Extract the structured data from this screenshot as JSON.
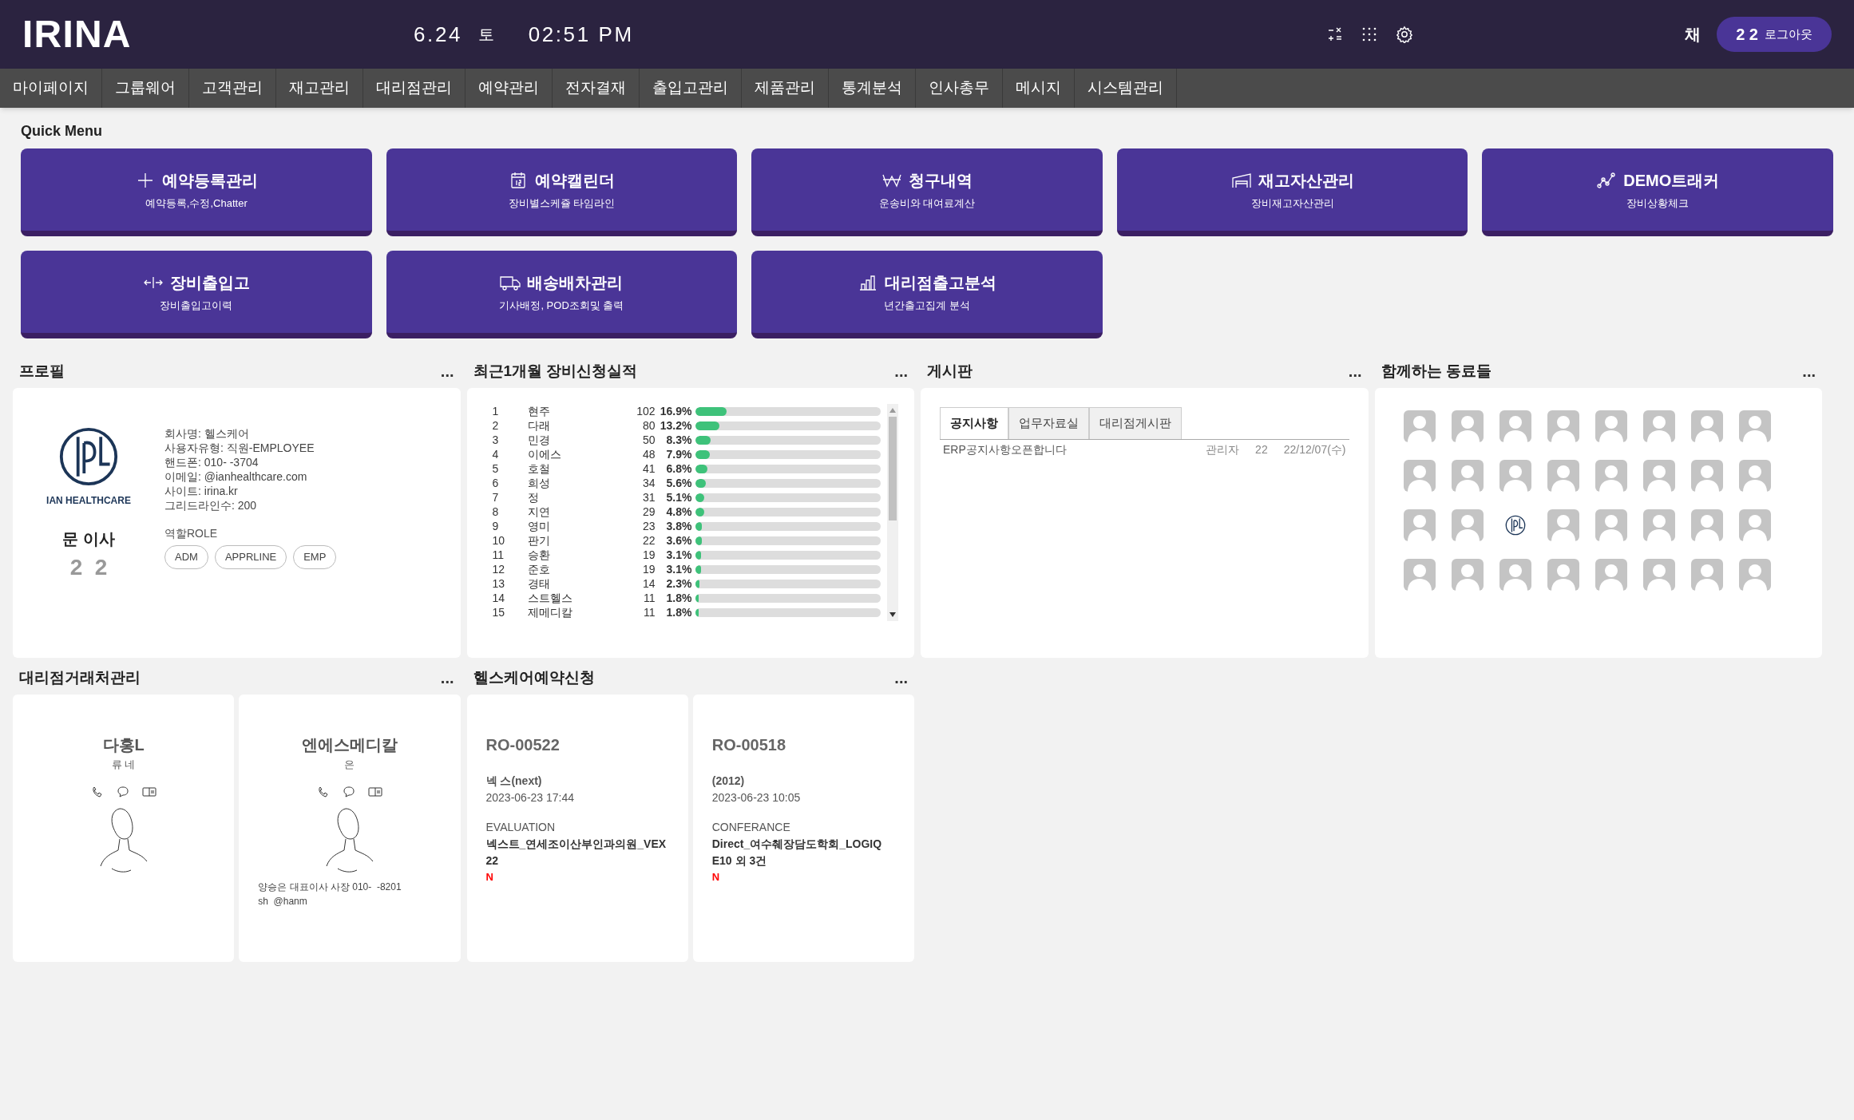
{
  "header": {
    "logo": "IRINA",
    "date": "6.24",
    "weekday": "토",
    "time": "02:51 PM",
    "user": "채",
    "logout": {
      "id": "2  2",
      "label": "로그아웃"
    }
  },
  "nav": [
    "마이페이지",
    "그룹웨어",
    "고객관리",
    "재고관리",
    "대리점관리",
    "예약관리",
    "전자결재",
    "출입고관리",
    "제품관리",
    "통계분석",
    "인사총무",
    "메시지",
    "시스템관리"
  ],
  "quick_menu": {
    "title": "Quick Menu",
    "items": [
      {
        "kind": "plus",
        "title": "예약등록관리",
        "subtitle": "예약등록,수정,Chatter"
      },
      {
        "kind": "calendar",
        "title": "예약캘린더",
        "subtitle": "장비별스케쥴 타임라인"
      },
      {
        "kind": "won",
        "title": "청구내역",
        "subtitle": "운송비와 대여료계산"
      },
      {
        "kind": "warehouse",
        "title": "재고자산관리",
        "subtitle": "장비재고자산관리"
      },
      {
        "kind": "tracker",
        "title": "DEMO트래커",
        "subtitle": "장비상황체크"
      },
      {
        "kind": "arrows",
        "title": "장비출입고",
        "subtitle": "장비출입고이력"
      },
      {
        "kind": "truck",
        "title": "배송배차관리",
        "subtitle": "기사배정, POD조회및 출력"
      },
      {
        "kind": "chart",
        "title": "대리점출고분석",
        "subtitle": "년간출고집계 분석"
      }
    ]
  },
  "profile": {
    "title": "프로필",
    "more": "...",
    "logo_text": "IAN HEALTHCARE",
    "name": "문 이사",
    "id": "2  2",
    "info": [
      "회사명: 헬스케어",
      "사용자유형: 직원-EMPLOYEE",
      "핸드폰: 010-  -3704",
      "이메일: @ianhealthcare.com",
      "사이트: irina.kr",
      "그리드라인수: 200"
    ],
    "role_label": "역할ROLE",
    "roles": [
      "ADM",
      "APPRLINE",
      "EMP"
    ]
  },
  "ranking": {
    "title": "최근1개월 장비신청실적",
    "more": "...",
    "rows": [
      {
        "rank": "1",
        "name": "현주",
        "count": "102",
        "pct": "16.9%",
        "level": 0.169
      },
      {
        "rank": "2",
        "name": "다래",
        "count": "80",
        "pct": "13.2%",
        "level": 0.132
      },
      {
        "rank": "3",
        "name": "민경",
        "count": "50",
        "pct": "8.3%",
        "level": 0.083
      },
      {
        "rank": "4",
        "name": "이에스",
        "count": "48",
        "pct": "7.9%",
        "level": 0.079
      },
      {
        "rank": "5",
        "name": "호철",
        "count": "41",
        "pct": "6.8%",
        "level": 0.068
      },
      {
        "rank": "6",
        "name": "희성",
        "count": "34",
        "pct": "5.6%",
        "level": 0.056
      },
      {
        "rank": "7",
        "name": "정",
        "count": "31",
        "pct": "5.1%",
        "level": 0.051
      },
      {
        "rank": "8",
        "name": "지연",
        "count": "29",
        "pct": "4.8%",
        "level": 0.048
      },
      {
        "rank": "9",
        "name": "영미",
        "count": "23",
        "pct": "3.8%",
        "level": 0.038
      },
      {
        "rank": "10",
        "name": "판기",
        "count": "22",
        "pct": "3.6%",
        "level": 0.036
      },
      {
        "rank": "11",
        "name": "승환",
        "count": "19",
        "pct": "3.1%",
        "level": 0.031
      },
      {
        "rank": "12",
        "name": "준호",
        "count": "19",
        "pct": "3.1%",
        "level": 0.031
      },
      {
        "rank": "13",
        "name": "경태",
        "count": "14",
        "pct": "2.3%",
        "level": 0.023
      },
      {
        "rank": "14",
        "name": "스트헬스",
        "count": "11",
        "pct": "1.8%",
        "level": 0.018
      },
      {
        "rank": "15",
        "name": "제메디칼",
        "count": "11",
        "pct": "1.8%",
        "level": 0.018
      }
    ]
  },
  "board": {
    "title": "게시판",
    "more": "...",
    "tabs": [
      {
        "label": "공지사항",
        "selected": true
      },
      {
        "label": "업무자료실",
        "selected": false
      },
      {
        "label": "대리점게시판",
        "selected": false
      }
    ],
    "posts": [
      {
        "title": "ERP공지사항오픈합니다",
        "author": "관리자",
        "views": "22",
        "date": "22/12/07(수)"
      }
    ]
  },
  "colleagues": {
    "title": "함께하는 동료들",
    "more": "...",
    "members": [
      {
        "kind": "avatar"
      },
      {
        "kind": "avatar"
      },
      {
        "kind": "avatar"
      },
      {
        "kind": "avatar"
      },
      {
        "kind": "avatar"
      },
      {
        "kind": "avatar"
      },
      {
        "kind": "avatar"
      },
      {
        "kind": "avatar"
      },
      {
        "kind": "avatar"
      },
      {
        "kind": "avatar"
      },
      {
        "kind": "avatar"
      },
      {
        "kind": "avatar"
      },
      {
        "kind": "avatar"
      },
      {
        "kind": "avatar"
      },
      {
        "kind": "avatar"
      },
      {
        "kind": "avatar"
      },
      {
        "kind": "avatar"
      },
      {
        "kind": "avatar"
      },
      {
        "kind": "logo"
      },
      {
        "kind": "avatar"
      },
      {
        "kind": "avatar"
      },
      {
        "kind": "avatar"
      },
      {
        "kind": "avatar"
      },
      {
        "kind": "avatar"
      },
      {
        "kind": "avatar"
      },
      {
        "kind": "avatar"
      },
      {
        "kind": "avatar"
      },
      {
        "kind": "avatar"
      },
      {
        "kind": "avatar"
      },
      {
        "kind": "avatar"
      },
      {
        "kind": "avatar"
      },
      {
        "kind": "avatar"
      }
    ]
  },
  "dealers": {
    "title": "대리점거래처관리",
    "more": "...",
    "cards": [
      {
        "name": "다홍L",
        "contact": "류 네"
      },
      {
        "name": "엔에스메디칼",
        "contact": "은",
        "notes": [
          "양승은 대표이사 사장 010-  -8201",
          "sh  @hanm"
        ]
      }
    ]
  },
  "reservations": {
    "title": "헬스케어예약신청",
    "more": "...",
    "cards": [
      {
        "code": "RO-00522",
        "customer": "넥 스(next)",
        "datetime": "2023-06-23 17:44",
        "type": "EVALUATION",
        "subject": "넥스트_연세조이산부인과의원_VEX 22",
        "new_mark": "N"
      },
      {
        "code": "RO-00518",
        "customer": "(2012)",
        "datetime": "2023-06-23 10:05",
        "type": "CONFERANCE",
        "subject": "Direct_여수췌장담도학회_LOGIQ E10 외 3건",
        "new_mark": "N"
      }
    ]
  }
}
